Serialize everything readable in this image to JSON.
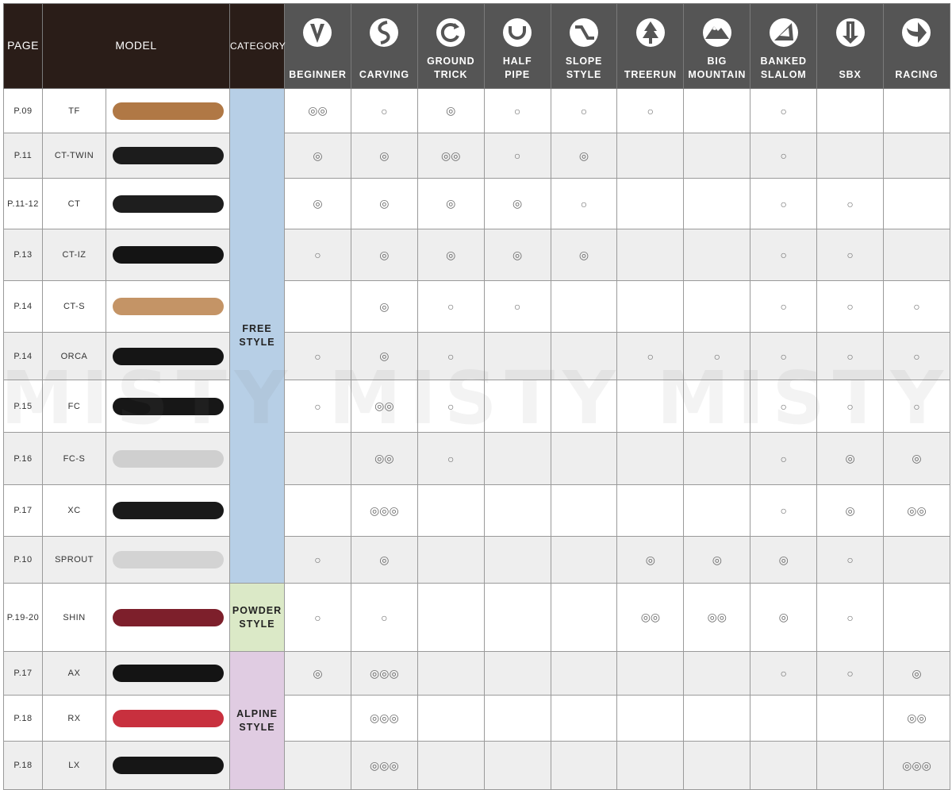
{
  "header": {
    "page": "PAGE",
    "model": "MODEL",
    "category": "CATEGORY",
    "uses": [
      {
        "label": "BEGINNER",
        "icon": "beginner-icon"
      },
      {
        "label": "CARVING",
        "icon": "carving-icon"
      },
      {
        "label": "GROUND\nTRICK",
        "icon": "ground-trick-icon"
      },
      {
        "label": "HALF\nPIPE",
        "icon": "half-pipe-icon"
      },
      {
        "label": "SLOPE\nSTYLE",
        "icon": "slope-style-icon"
      },
      {
        "label": "TREERUN",
        "icon": "treerun-icon"
      },
      {
        "label": "BIG\nMOUNTAIN",
        "icon": "big-mountain-icon"
      },
      {
        "label": "BANKED\nSLALOM",
        "icon": "banked-slalom-icon"
      },
      {
        "label": "SBX",
        "icon": "sbx-icon"
      },
      {
        "label": "RACING",
        "icon": "racing-icon"
      }
    ]
  },
  "categories": [
    {
      "label": "FREE\nSTYLE",
      "rows": 10
    },
    {
      "label": "POWDER\nSTYLE",
      "rows": 1
    },
    {
      "label": "ALPINE\nSTYLE",
      "rows": 3
    }
  ],
  "rows": [
    {
      "page": "P.09",
      "model": "TF",
      "board_color": "#b07845",
      "marks": [
        "◎◎",
        "○",
        "◎",
        "○",
        "○",
        "○",
        "",
        "○",
        "",
        ""
      ]
    },
    {
      "page": "P.11",
      "model": "CT-TWIN",
      "board_color": "#1c1c1c",
      "marks": [
        "◎",
        "◎",
        "◎◎",
        "○",
        "◎",
        "",
        "",
        "○",
        "",
        ""
      ]
    },
    {
      "page": "P.11-12",
      "model": "CT",
      "board_color": "#1e1e1e",
      "marks": [
        "◎",
        "◎",
        "◎",
        "◎",
        "○",
        "",
        "",
        "○",
        "○",
        ""
      ]
    },
    {
      "page": "P.13",
      "model": "CT-IZ",
      "board_color": "#141414",
      "marks": [
        "○",
        "◎",
        "◎",
        "◎",
        "◎",
        "",
        "",
        "○",
        "○",
        ""
      ]
    },
    {
      "page": "P.14",
      "model": "CT-S",
      "board_color": "#c49466",
      "marks": [
        "",
        "◎",
        "○",
        "○",
        "",
        "",
        "",
        "○",
        "○",
        "○"
      ]
    },
    {
      "page": "P.14",
      "model": "ORCA",
      "board_color": "#151515",
      "marks": [
        "○",
        "◎",
        "○",
        "",
        "",
        "○",
        "○",
        "○",
        "○",
        "○"
      ]
    },
    {
      "page": "P.15",
      "model": "FC",
      "board_color": "#171717",
      "marks": [
        "○",
        "◎◎",
        "○",
        "",
        "",
        "",
        "",
        "○",
        "○",
        "○"
      ]
    },
    {
      "page": "P.16",
      "model": "FC-S",
      "board_color": "#cfcfcf",
      "marks": [
        "",
        "◎◎",
        "○",
        "",
        "",
        "",
        "",
        "○",
        "◎",
        "◎"
      ]
    },
    {
      "page": "P.17",
      "model": "XC",
      "board_color": "#1a1a1a",
      "marks": [
        "",
        "◎◎◎",
        "",
        "",
        "",
        "",
        "",
        "○",
        "◎",
        "◎◎"
      ]
    },
    {
      "page": "P.10",
      "model": "SPROUT",
      "board_color": "#d3d3d3",
      "marks": [
        "○",
        "◎",
        "",
        "",
        "",
        "◎",
        "◎",
        "◎",
        "○",
        ""
      ]
    },
    {
      "page": "P.19-20",
      "model": "SHIN",
      "board_color": "#7d1f2b",
      "marks": [
        "○",
        "○",
        "",
        "",
        "",
        "◎◎",
        "◎◎",
        "◎",
        "○",
        ""
      ]
    },
    {
      "page": "P.17",
      "model": "AX",
      "board_color": "#141414",
      "marks": [
        "◎",
        "◎◎◎",
        "",
        "",
        "",
        "",
        "",
        "○",
        "○",
        "◎"
      ]
    },
    {
      "page": "P.18",
      "model": "RX",
      "board_color": "#c8303e",
      "marks": [
        "",
        "◎◎◎",
        "",
        "",
        "",
        "",
        "",
        "",
        "",
        "◎◎"
      ]
    },
    {
      "page": "P.18",
      "model": "LX",
      "board_color": "#161616",
      "marks": [
        "",
        "◎◎◎",
        "",
        "",
        "",
        "",
        "",
        "",
        "",
        "◎◎◎"
      ]
    }
  ],
  "watermark": "MISTY MISTY MISTY"
}
